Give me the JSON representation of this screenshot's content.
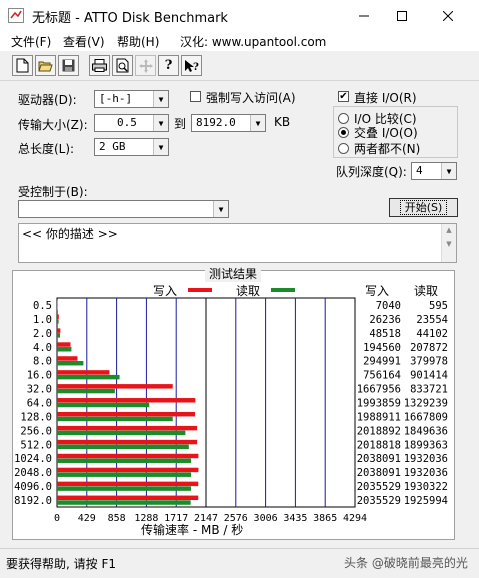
{
  "window": {
    "title": "无标题 - ATTO Disk Benchmark",
    "minimize_icon": "minimize-icon",
    "maximize_icon": "maximize-icon",
    "close_icon": "close-icon"
  },
  "menu": {
    "items": [
      "文件(F)",
      "查看(V)",
      "帮助(H)",
      "汉化: www.upantool.com"
    ]
  },
  "toolbar": {
    "icons": [
      "new-document-icon",
      "open-folder-icon",
      "save-icon",
      "print-icon",
      "print-preview-icon",
      "move-icon",
      "help-icon",
      "context-help-icon"
    ]
  },
  "settings": {
    "drive_label": "驱动器(D):",
    "drive_value": "[-h-]",
    "force_write_label": "强制写入访问(A)",
    "transfer_size_label": "传输大小(Z):",
    "transfer_from": "0.5",
    "to_label": "到",
    "transfer_to": "8192.0",
    "kb_label": "KB",
    "total_length_label": "总长度(L):",
    "total_length_value": "2 GB",
    "direct_io_label": "直接 I/O(R)",
    "direct_io_checked": true,
    "io_compare_label": "I/O 比较(C)",
    "overlapped_io_label": "交叠 I/O(O)",
    "neither_label": "两者都不(N)",
    "queue_depth_label": "队列深度(Q):",
    "queue_depth_value": "4",
    "controlled_by_label": "受控制于(B):",
    "controlled_by_value": "",
    "start_button": "开始(S)",
    "description": "<<  你的描述   >>"
  },
  "results": {
    "frame_title": "测试结果",
    "legend_write": "写入",
    "legend_read": "读取",
    "col_write": "写入",
    "col_read": "读取",
    "xlabel": "传输速率 - MB / 秒"
  },
  "chart_data": {
    "type": "bar",
    "orientation": "horizontal",
    "categories": [
      "0.5",
      "1.0",
      "2.0",
      "4.0",
      "8.0",
      "16.0",
      "32.0",
      "64.0",
      "128.0",
      "256.0",
      "512.0",
      "1024.0",
      "2048.0",
      "4096.0",
      "8192.0"
    ],
    "series": [
      {
        "name": "写入",
        "color": "#e8141a",
        "values": [
          7040,
          26236,
          48518,
          194560,
          294991,
          756164,
          1667956,
          1993859,
          1988911,
          2018892,
          2018818,
          2038091,
          2038091,
          2035529,
          2035529
        ]
      },
      {
        "name": "读取",
        "color": "#1a8c2a",
        "values": [
          595,
          23554,
          44102,
          207872,
          379978,
          901414,
          833721,
          1329239,
          1667809,
          1849636,
          1899363,
          1932036,
          1932036,
          1930322,
          1925994
        ]
      }
    ],
    "x_ticks": [
      "0",
      "429",
      "858",
      "1288",
      "1717",
      "2147",
      "2576",
      "3006",
      "3435",
      "3865",
      "4294"
    ],
    "xlim": [
      0,
      4294
    ],
    "value_unit_divisor": 1000,
    "xlabel": "传输速率 - MB / 秒",
    "grid": true
  },
  "status": {
    "text": "要获得帮助, 请按 F1",
    "watermark": "头条 @破晓前最亮的光"
  }
}
